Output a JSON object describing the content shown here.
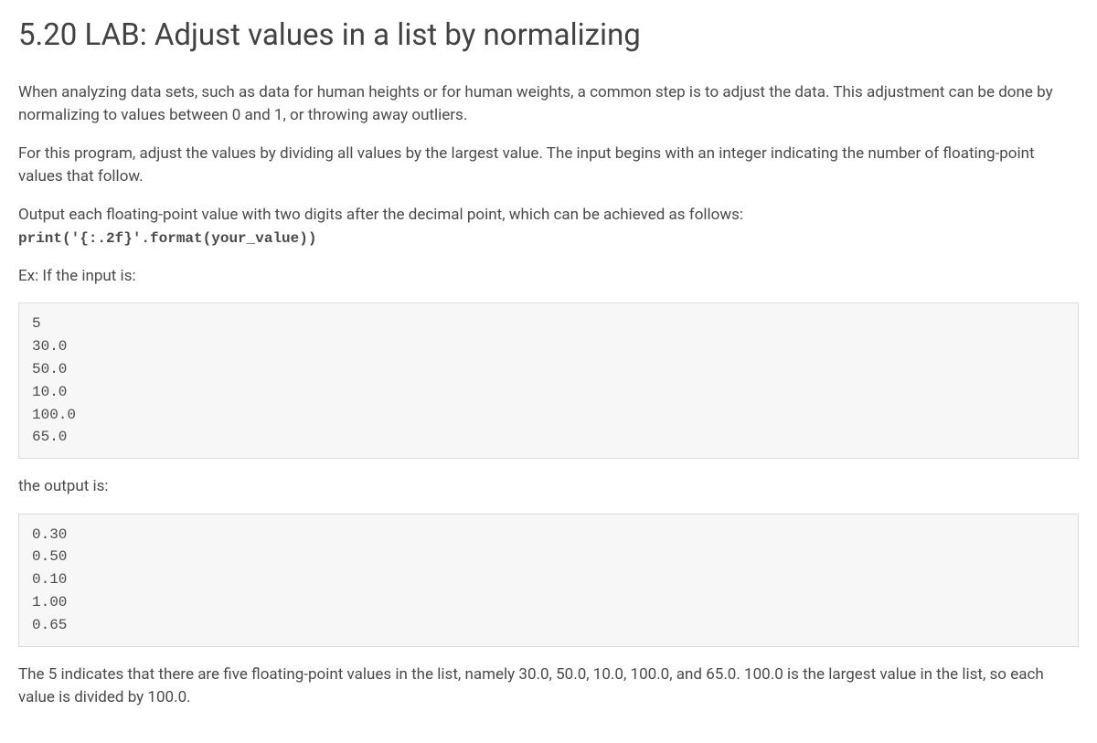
{
  "heading": "5.20 LAB: Adjust values in a list by normalizing",
  "para1": "When analyzing data sets, such as data for human heights or for human weights, a common step is to adjust the data. This adjustment can be done by normalizing to values between 0 and 1, or throwing away outliers.",
  "para2": "For this program, adjust the values by dividing all values by the largest value. The input begins with an integer indicating the number of floating-point values that follow.",
  "para3_pre": "Output each floating-point value with two digits after the decimal point, which can be achieved as follows:",
  "para3_code": "print('{:.2f}'.format(your_value))",
  "para4": "Ex: If the input is:",
  "codeblock1": "5\n30.0\n50.0\n10.0\n100.0\n65.0",
  "para5": "the output is:",
  "codeblock2": "0.30\n0.50\n0.10\n1.00\n0.65",
  "para6": "The 5 indicates that there are five floating-point values in the list, namely 30.0, 50.0, 10.0, 100.0, and 65.0. 100.0 is the largest value in the list, so each value is divided by 100.0."
}
